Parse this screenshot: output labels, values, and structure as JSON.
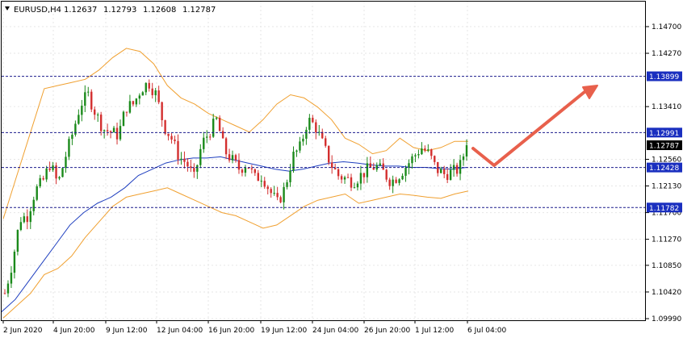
{
  "header": {
    "symbol": "EURUSD,H4",
    "open": "1.12637",
    "high": "1.12793",
    "low": "1.12608",
    "close": "1.12787"
  },
  "colors": {
    "bull": "#26a69a",
    "bull_dark": "#1b8a1b",
    "bear": "#d32f2f",
    "bands": "#f0a030",
    "ma": "#1f3fbf",
    "level_line": "#1a1a8c",
    "badge_bg": "#1a2fbf",
    "arrow": "#e8604c",
    "grid": "#e6e6e6"
  },
  "chart_data": {
    "type": "candlestick",
    "symbol": "EURUSD",
    "timeframe": "H4",
    "ylim": [
      1.0999,
      1.1492
    ],
    "y_ticks": [
      "1.14700",
      "1.14270",
      "1.13410",
      "1.12560",
      "1.12130",
      "1.11700",
      "1.11270",
      "1.10850",
      "1.10420",
      "1.09990"
    ],
    "x_ticks": [
      "2 Jun 2020",
      "4 Jun 20:00",
      "9 Jun 12:00",
      "12 Jun 04:00",
      "16 Jun 20:00",
      "19 Jun 12:00",
      "24 Jun 04:00",
      "26 Jun 20:00",
      "1 Jul 12:00",
      "6 Jul 04:00"
    ],
    "levels": [
      {
        "value": 1.13899,
        "label": "1.13899"
      },
      {
        "value": 1.12991,
        "label": "1.12991"
      },
      {
        "value": 1.12428,
        "label": "1.12428"
      },
      {
        "value": 1.11782,
        "label": "1.11782"
      }
    ],
    "current_price": {
      "value": 1.12787,
      "label": "1.12787"
    },
    "close_path": [
      1.104,
      1.109,
      1.116,
      1.1165,
      1.1205,
      1.122,
      1.125,
      1.1215,
      1.126,
      1.13,
      1.1345,
      1.136,
      1.133,
      1.1305,
      1.13,
      1.1295,
      1.134,
      1.1345,
      1.137,
      1.138,
      1.136,
      1.131,
      1.129,
      1.126,
      1.125,
      1.1225,
      1.128,
      1.13,
      1.132,
      1.127,
      1.1255,
      1.124,
      1.125,
      1.1225,
      1.123,
      1.1205,
      1.1185,
      1.121,
      1.126,
      1.1275,
      1.132,
      1.131,
      1.128,
      1.125,
      1.123,
      1.1225,
      1.122,
      1.123,
      1.124,
      1.1245,
      1.1235,
      1.122,
      1.123,
      1.1245,
      1.126,
      1.1275,
      1.1265,
      1.124,
      1.1232,
      1.1235,
      1.124,
      1.1279
    ],
    "ma_path": [
      1.101,
      1.103,
      1.106,
      1.109,
      1.112,
      1.115,
      1.117,
      1.1185,
      1.1195,
      1.121,
      1.123,
      1.124,
      1.125,
      1.1255,
      1.1258,
      1.1258,
      1.126,
      1.1255,
      1.125,
      1.1245,
      1.124,
      1.1237,
      1.124,
      1.1245,
      1.125,
      1.1252,
      1.125,
      1.1247,
      1.1245,
      1.1245,
      1.1243,
      1.1243,
      1.1241,
      1.124,
      1.1243
    ],
    "band_upper": [
      1.116,
      1.123,
      1.13,
      1.137,
      1.1375,
      1.138,
      1.1385,
      1.14,
      1.142,
      1.1435,
      1.143,
      1.141,
      1.1375,
      1.1355,
      1.1345,
      1.133,
      1.132,
      1.131,
      1.13,
      1.132,
      1.1345,
      1.136,
      1.1355,
      1.134,
      1.132,
      1.129,
      1.128,
      1.1265,
      1.127,
      1.129,
      1.1275,
      1.127,
      1.1275,
      1.1285,
      1.1285
    ],
    "band_lower": [
      1.1,
      1.102,
      1.104,
      1.107,
      1.108,
      1.11,
      1.113,
      1.1155,
      1.118,
      1.1195,
      1.12,
      1.1205,
      1.121,
      1.12,
      1.119,
      1.118,
      1.117,
      1.1165,
      1.1155,
      1.1145,
      1.115,
      1.1165,
      1.118,
      1.119,
      1.1195,
      1.12,
      1.1185,
      1.119,
      1.1195,
      1.12,
      1.1198,
      1.1195,
      1.1193,
      1.12,
      1.1205
    ]
  }
}
